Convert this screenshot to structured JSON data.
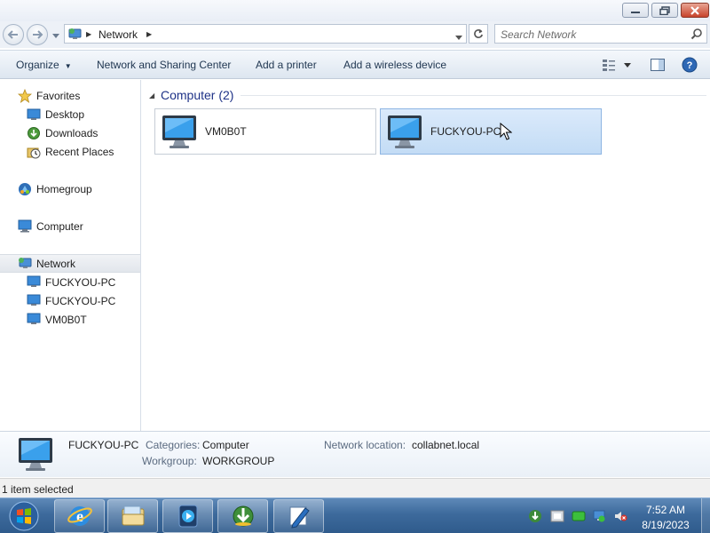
{
  "window": {
    "controls": [
      "minimize",
      "maximize",
      "close"
    ]
  },
  "address": {
    "path": [
      "Network"
    ],
    "search_placeholder": "Search Network"
  },
  "toolbar": {
    "organize_label": "Organize",
    "network_sharing_label": "Network and Sharing Center",
    "add_printer_label": "Add a printer",
    "add_wireless_label": "Add a wireless device"
  },
  "sidebar": {
    "favorites": {
      "label": "Favorites",
      "items": [
        {
          "label": "Desktop",
          "icon": "desktop-icon"
        },
        {
          "label": "Downloads",
          "icon": "downloads-icon"
        },
        {
          "label": "Recent Places",
          "icon": "recent-places-icon"
        }
      ]
    },
    "homegroup": {
      "label": "Homegroup"
    },
    "computer": {
      "label": "Computer"
    },
    "network": {
      "label": "Network",
      "selected": true,
      "items": [
        {
          "label": "FUCKYOU-PC"
        },
        {
          "label": "FUCKYOU-PC"
        },
        {
          "label": "VM0B0T"
        }
      ]
    }
  },
  "content": {
    "group_title": "Computer (2)",
    "tiles": [
      {
        "label": "VM0B0T",
        "hovered": false
      },
      {
        "label": "FUCKYOU-PC",
        "hovered": true
      }
    ]
  },
  "details": {
    "name": "FUCKYOU-PC",
    "categories_label": "Categories:",
    "categories_value": "Computer",
    "workgroup_label": "Workgroup:",
    "workgroup_value": "WORKGROUP",
    "network_location_label": "Network location:",
    "network_location_value": "collabnet.local"
  },
  "status": {
    "text": "1 item selected"
  },
  "taskbar": {
    "pinned": [
      "internet-explorer-icon",
      "windows-explorer-icon",
      "media-player-icon",
      "download-manager-icon",
      "editor-icon"
    ],
    "time": "7:52 AM",
    "date": "8/19/2023"
  },
  "colors": {
    "accent": "#1e3287",
    "tile_hover": "#c3dcf5",
    "taskbar": "#3d6a9c",
    "close_button": "#c7432b"
  }
}
